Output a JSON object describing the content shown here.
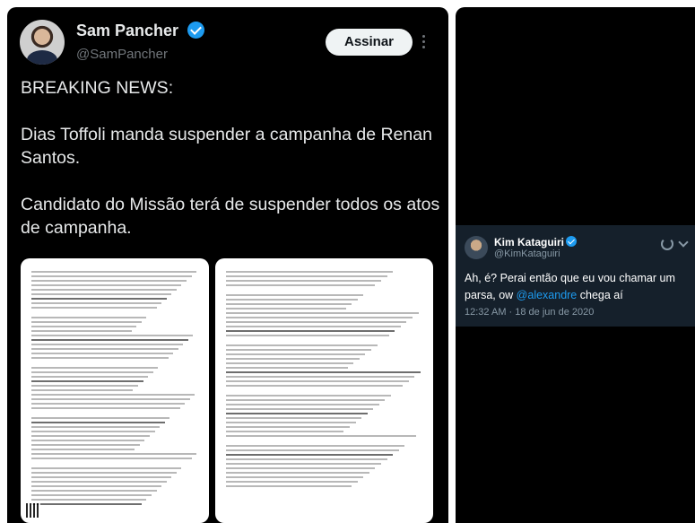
{
  "tweet": {
    "display_name": "Sam Pancher",
    "handle": "@SamPancher",
    "follow_label": "Assinar",
    "paragraphs": [
      "BREAKING NEWS:",
      "Dias Toffoli manda suspender a campanha de Renan Santos.",
      "Candidato do Missão terá de suspender todos os atos de campanha."
    ]
  },
  "embed": {
    "display_name": "Kim Kataguiri",
    "handle": "@KimKataguiri",
    "text_before": "Ah, é? Perai então que eu vou chamar um parsa, ow ",
    "mention": "@alexandre",
    "text_after": " chega aí",
    "timestamp": "12:32 AM · 18 de jun de 2020"
  },
  "colors": {
    "background": "#000000",
    "verified": "#1d9bf0",
    "embed_bg": "#15202b"
  }
}
